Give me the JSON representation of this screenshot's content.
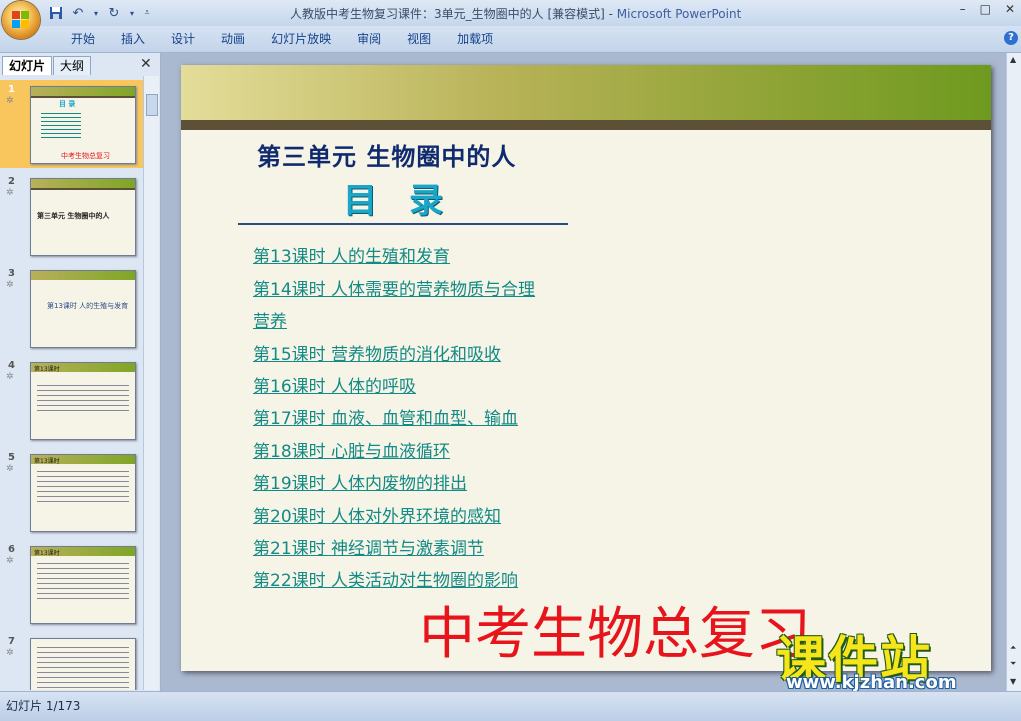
{
  "window": {
    "title": "人教版中考生物复习课件：3单元_生物圈中的人 [兼容模式]",
    "app_name": "Microsoft PowerPoint",
    "title_separator": " - ",
    "minimize": "–",
    "maximize": "□",
    "close": "✕"
  },
  "quick_access": {
    "save_icon": "floppy-disk-icon",
    "undo_icon": "undo-icon",
    "redo_icon": "redo-icon"
  },
  "ribbon": {
    "tabs": [
      "开始",
      "插入",
      "设计",
      "动画",
      "幻灯片放映",
      "审阅",
      "视图",
      "加载项"
    ],
    "help": "?"
  },
  "left_pane": {
    "tab_slides": "幻灯片",
    "tab_outline": "大纲",
    "close": "✕",
    "slides": [
      {
        "num": "1",
        "title": "目  录",
        "footer": "中考生物总复习",
        "selected": true
      },
      {
        "num": "2",
        "title": "第三单元  生物圈中的人"
      },
      {
        "num": "3",
        "title": "第13课时  人的生殖与发育"
      },
      {
        "num": "4",
        "title": "第13课时"
      },
      {
        "num": "5",
        "title": "第13课时"
      },
      {
        "num": "6",
        "title": "第13课时"
      },
      {
        "num": "7",
        "title": ""
      }
    ],
    "star": "✲"
  },
  "slide": {
    "unit_title": "第三单元   生物圈中的人",
    "toc_title": "目录",
    "items": [
      "第13课时   人的生殖和发育",
      "第14课时   人体需要的营养物质与合理",
      "营养",
      "第15课时   营养物质的消化和吸收",
      "第16课时   人体的呼吸",
      "第17课时   血液、血管和血型、输血",
      "第18课时   心脏与血液循环",
      "第19课时   人体内废物的排出",
      "第20课时   人体对外界环境的感知",
      "第21课时   神经调节与激素调节",
      "第22课时   人类活动对生物圈的影响"
    ],
    "banner": "中考生物总复习"
  },
  "watermark": {
    "main": "课件站",
    "url": "www.kjzhan.com"
  },
  "status": {
    "text": "幻灯片 1/173"
  }
}
